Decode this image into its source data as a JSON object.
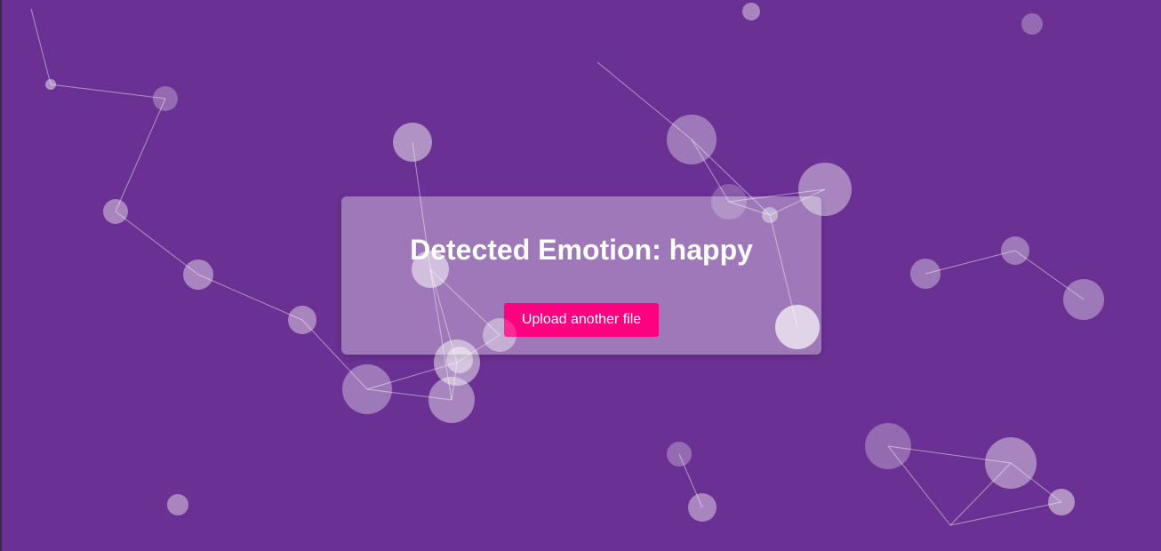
{
  "page": {
    "background_color": "#6a3093",
    "accent_color": "#ff0080"
  },
  "result": {
    "title": "Detected Emotion: happy",
    "upload_button_label": "Upload another file"
  }
}
